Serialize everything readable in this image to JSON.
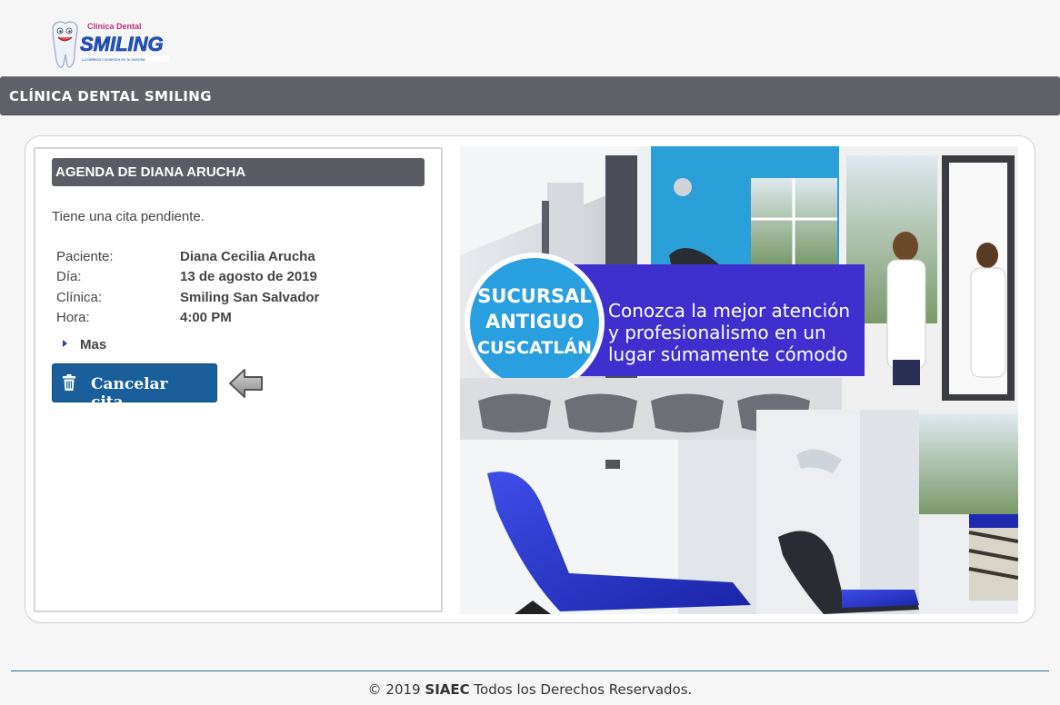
{
  "logo": {
    "top_text": "Clínica Dental",
    "brand": "SMILING",
    "tagline": "La belleza comienza en tu sonrisa"
  },
  "header": {
    "title": "CLÍNICA DENTAL SMILING"
  },
  "agenda": {
    "title": "AGENDA DE DIANA ARUCHA",
    "pending_text": "Tiene una cita pendiente.",
    "fields": [
      {
        "label": "Paciente:",
        "value": "Diana Cecilia Arucha"
      },
      {
        "label": "Día:",
        "value": "13 de agosto de 2019"
      },
      {
        "label": "Clínica:",
        "value": "Smiling San Salvador"
      },
      {
        "label": "Hora:",
        "value": "4:00 PM"
      }
    ],
    "more_label": "Mas",
    "cancel_label": "Cancelar cita"
  },
  "promo": {
    "badge_lines": [
      "SUCURSAL",
      "ANTIGUO",
      "CUSCATLÁN"
    ],
    "banner_lines": [
      "Conozca la mejor atención",
      "y profesionalismo  en un",
      "lugar súmamente cómodo"
    ]
  },
  "footer": {
    "copyright": "© 2019",
    "company": "SIAEC",
    "rights": "Todos los Derechos Reservados."
  },
  "colors": {
    "title_bar": "#5f6068",
    "button": "#1a5f9c",
    "banner": "#3f2fcf",
    "badge": "#2a9fe0"
  }
}
